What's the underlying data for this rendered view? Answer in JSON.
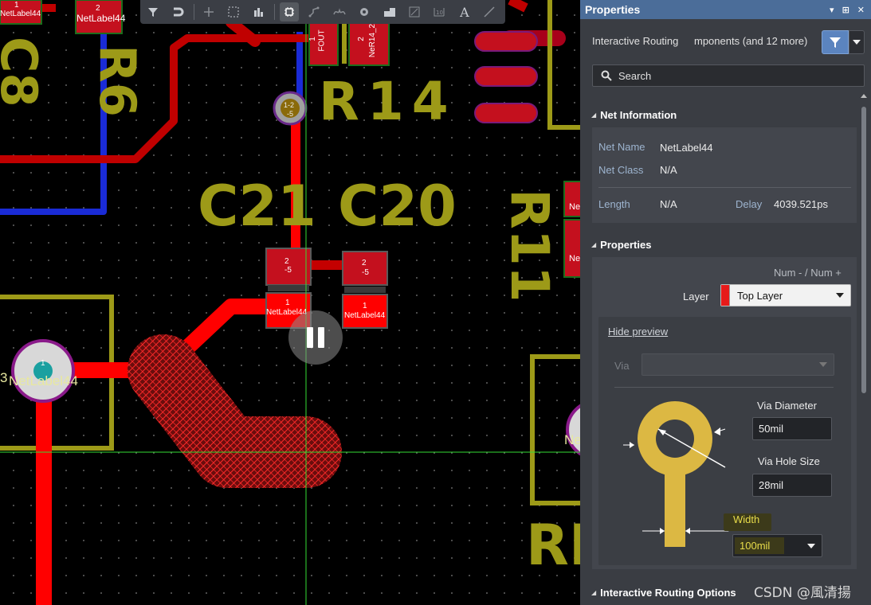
{
  "canvas": {
    "labels": {
      "c8": "C8",
      "r6": "R6",
      "r14": "R14",
      "c21": "C21",
      "c20": "C20",
      "r11": "R11",
      "r_partial": "RI"
    },
    "pads": {
      "topleft_num": "1",
      "topleft_net": "NetLabel44",
      "top2_num": "2",
      "top2_net": "NetLabel44",
      "fout_num": "1",
      "fout_net": "FOUT",
      "ner14_num": "2",
      "ner14_net": "NeR14_2",
      "via_label_top": "1-2",
      "via_label_bottom": "-5",
      "c21_top_num": "2",
      "c21_top_net": "-5",
      "c20_top_num": "2",
      "c20_top_net": "-5",
      "c21_bot_num": "1",
      "c21_bot_net": "NetLabel44",
      "c20_bot_num": "1",
      "c20_bot_net": "NetLabel44",
      "left_pad_num": "1",
      "left_pad_net": "NetLabel44",
      "left_pad_prefix": "3",
      "right_partial_a": "Ne",
      "right_partial_b": "Ne",
      "right_partial_c": "Ne"
    }
  },
  "toolbar": {
    "tools": [
      "filter-icon",
      "magnet-icon",
      "plus-icon",
      "select-rect-icon",
      "bar-chart-icon",
      "component-icon",
      "route-icon",
      "diff-pair-icon",
      "via-icon",
      "polygon-icon",
      "region-icon",
      "dimension-icon",
      "text-icon",
      "line-icon"
    ]
  },
  "panel": {
    "title": "Properties",
    "title_controls": [
      "▾",
      "⊞",
      "✕"
    ],
    "mode": "Interactive Routing",
    "components_summary": "mponents (and 12 more)",
    "search_placeholder": "Search",
    "net_info": {
      "header": "Net Information",
      "net_name_label": "Net Name",
      "net_name": "NetLabel44",
      "net_class_label": "Net Class",
      "net_class": "N/A",
      "length_label": "Length",
      "length": "N/A",
      "delay_label": "Delay",
      "delay": "4039.521ps"
    },
    "properties": {
      "header": "Properties",
      "num_nav": "Num - / Num +",
      "layer_label": "Layer",
      "layer_value": "Top Layer",
      "layer_color": "#e61a1a",
      "hide_preview": "Hide preview",
      "via_label": "Via",
      "via_value": "",
      "via_diameter_label": "Via Diameter",
      "via_diameter": "50mil",
      "via_hole_label": "Via Hole Size",
      "via_hole": "28mil",
      "width_label": "Width",
      "width_value": "100mil"
    },
    "routing_options_header": "Interactive Routing Options"
  },
  "watermark": "CSDN @風清揚",
  "colors": {
    "track": "#ff0000",
    "track_dark": "#b00000",
    "pad": "#c4101e",
    "silk": "#9d9a18",
    "panel_title": "#4b6d99",
    "via_preview": "#dcb843",
    "crosshair": "#33dd33"
  }
}
